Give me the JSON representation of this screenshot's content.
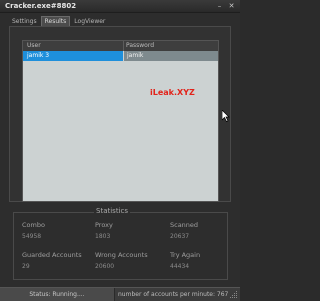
{
  "window": {
    "title": "Cracker.exe#8802",
    "minimize": "–",
    "close": "✕"
  },
  "tabs": [
    {
      "label": "Settings",
      "active": false
    },
    {
      "label": "Results",
      "active": true
    },
    {
      "label": "LogViewer",
      "active": false
    }
  ],
  "results": {
    "columns": [
      "User",
      "Password"
    ],
    "rows": [
      {
        "user": "jamik 3",
        "password": "jamik"
      }
    ]
  },
  "watermark": "iLeak.XYZ",
  "stats": {
    "title": "Statistics",
    "combo": {
      "label": "Combo",
      "value": "54958"
    },
    "proxy": {
      "label": "Proxy",
      "value": "1803"
    },
    "scanned": {
      "label": "Scanned",
      "value": "20637"
    },
    "guarded": {
      "label": "Guarded Accounts",
      "value": "29"
    },
    "wrong": {
      "label": "Wrong Accounts",
      "value": "20600"
    },
    "try_again": {
      "label": "Try Again",
      "value": "44434"
    }
  },
  "status": {
    "state": "Status: Running....",
    "rate": "number of accounts per minute: 767"
  },
  "colors": {
    "selection": "#1e8fdb",
    "watermark": "#e2231a"
  },
  "icons": [
    "minimize-icon",
    "close-icon",
    "mouse-cursor-icon",
    "resize-grip-icon"
  ]
}
